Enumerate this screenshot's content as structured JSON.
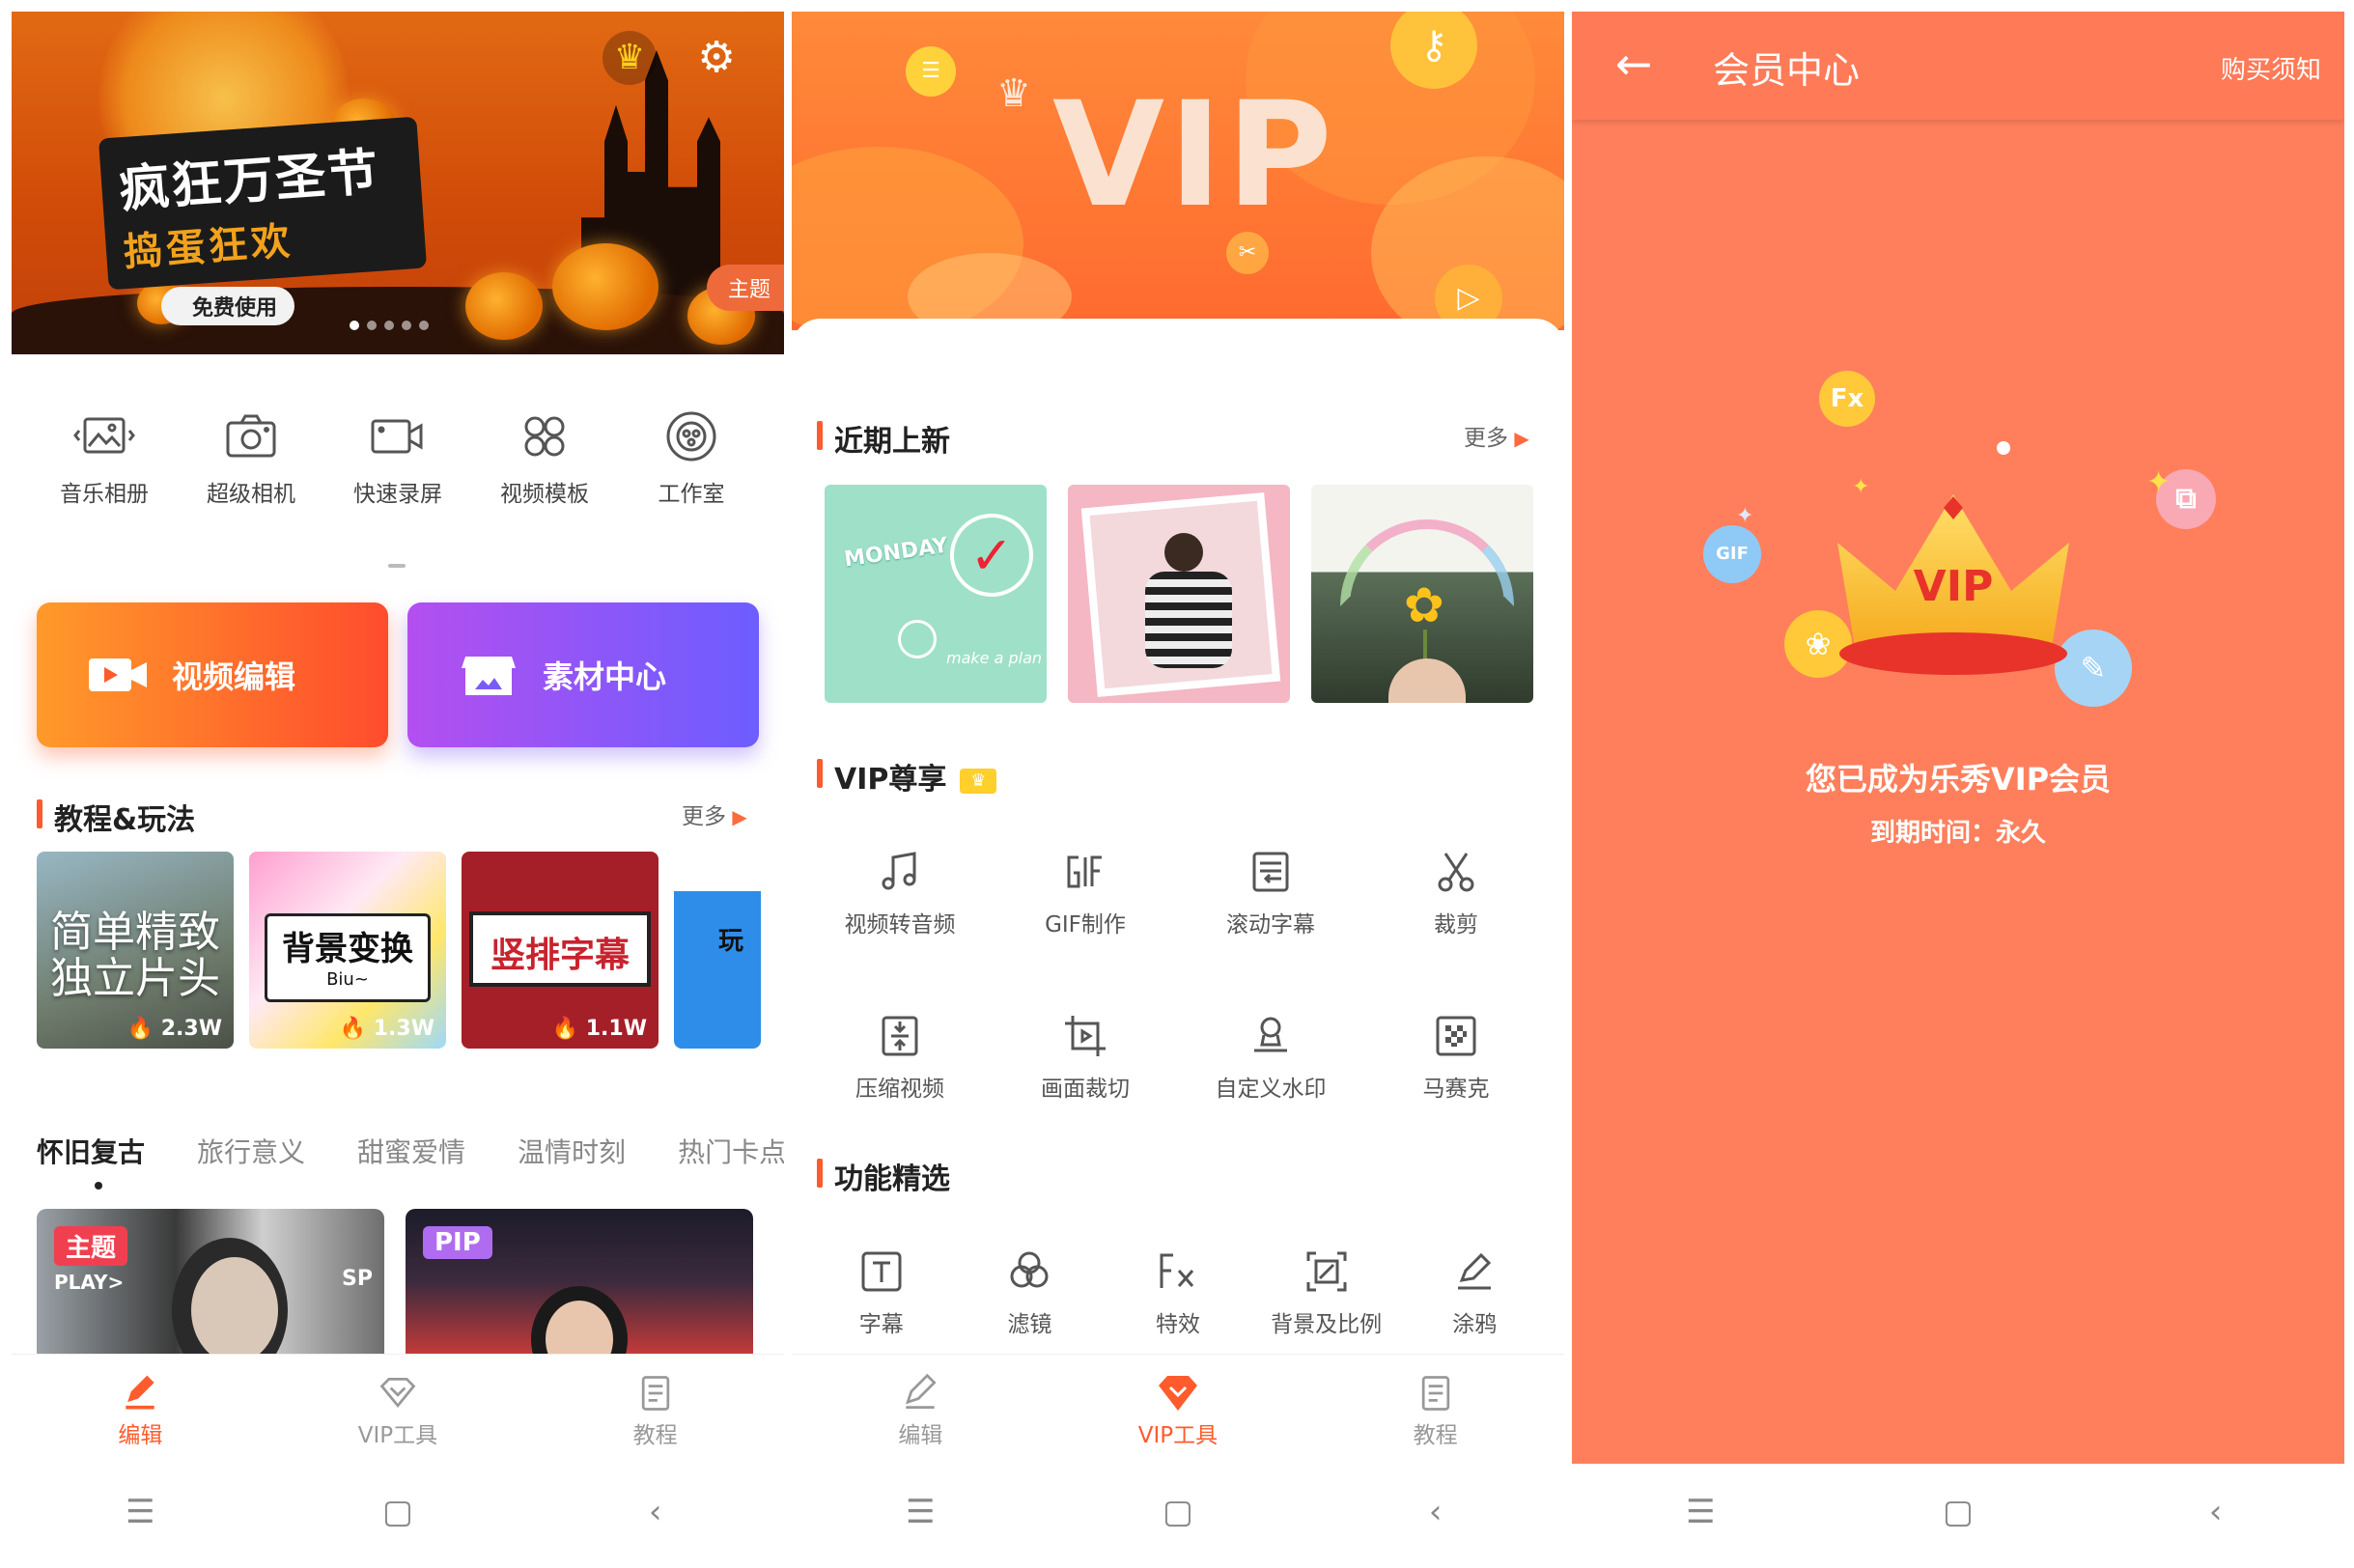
{
  "panel1": {
    "banner": {
      "title_line1": "疯狂万圣节",
      "title_line2": "捣蛋狂欢",
      "free_label": "免费使用",
      "theme_tag": "主题",
      "crown_icon": "crown-icon",
      "settings_icon": "gear-icon",
      "dots": 5,
      "active_dot": 0
    },
    "tools": [
      {
        "label": "音乐相册",
        "icon": "music-album-icon"
      },
      {
        "label": "超级相机",
        "icon": "camera-icon"
      },
      {
        "label": "快速录屏",
        "icon": "screen-record-icon"
      },
      {
        "label": "视频模板",
        "icon": "template-icon"
      },
      {
        "label": "工作室",
        "icon": "studio-icon"
      }
    ],
    "video_edit_label": "视频编辑",
    "material_center_label": "素材中心",
    "tutorial_title": "教程&玩法",
    "more_label": "更多",
    "tutorials": [
      {
        "text": "简单精致 独立片头",
        "count": "2.3W"
      },
      {
        "text": "背景变换",
        "sub": "Biu~",
        "count": "1.3W"
      },
      {
        "text": "竖排字幕",
        "count": "1.1W"
      },
      {
        "text": "玩"
      }
    ],
    "categories": [
      "怀旧复古",
      "旅行意义",
      "甜蜜爱情",
      "温情时刻",
      "热门卡点"
    ],
    "active_category": 0,
    "video_cards": [
      {
        "tag": "主题",
        "caption": "PLAY>",
        "corner": "SP"
      },
      {
        "tag": "PIP"
      }
    ]
  },
  "tabs": [
    {
      "label": "编辑",
      "icon": "edit-icon"
    },
    {
      "label": "VIP工具",
      "icon": "vip-diamond-icon"
    },
    {
      "label": "教程",
      "icon": "tutorial-icon"
    }
  ],
  "panel1_active_tab": 0,
  "panel2_active_tab": 1,
  "panel2": {
    "banner_text": "VIP",
    "recent_title": "近期上新",
    "more_label": "更多",
    "recent_items": [
      {
        "text": "MONDAY",
        "sub": "make a plan"
      },
      {
        "text": ""
      },
      {
        "text": ""
      }
    ],
    "vip_title": "VIP尊享",
    "vip_tools": [
      {
        "label": "视频转音频",
        "icon": "music-note-icon"
      },
      {
        "label": "GIF制作",
        "icon": "gif-icon"
      },
      {
        "label": "滚动字幕",
        "icon": "scroll-text-icon"
      },
      {
        "label": "裁剪",
        "icon": "scissors-icon"
      },
      {
        "label": "压缩视频",
        "icon": "compress-icon"
      },
      {
        "label": "画面裁切",
        "icon": "crop-icon"
      },
      {
        "label": "自定义水印",
        "icon": "watermark-icon"
      },
      {
        "label": "马赛克",
        "icon": "mosaic-icon"
      }
    ],
    "feature_title": "功能精选",
    "features": [
      {
        "label": "字幕",
        "icon": "text-icon"
      },
      {
        "label": "滤镜",
        "icon": "filter-icon"
      },
      {
        "label": "特效",
        "icon": "fx-icon"
      },
      {
        "label": "背景及比例",
        "icon": "ratio-icon"
      },
      {
        "label": "涂鸦",
        "icon": "doodle-icon"
      }
    ]
  },
  "panel3": {
    "title": "会员中心",
    "purchase_notice": "购买须知",
    "crown_text": "VIP",
    "fx_badge": "Fx",
    "gif_badge": "GIF",
    "member_message": "您已成为乐秀VIP会员",
    "expire_text": "到期时间：永久"
  },
  "system_nav": {
    "menu": "☰",
    "home": "▢",
    "back": "‹"
  },
  "colors": {
    "accent": "#ff5b2d",
    "vip_bg": "#ff7f5c",
    "purple": "#7a5cf5",
    "gold": "#ffcf2b"
  }
}
